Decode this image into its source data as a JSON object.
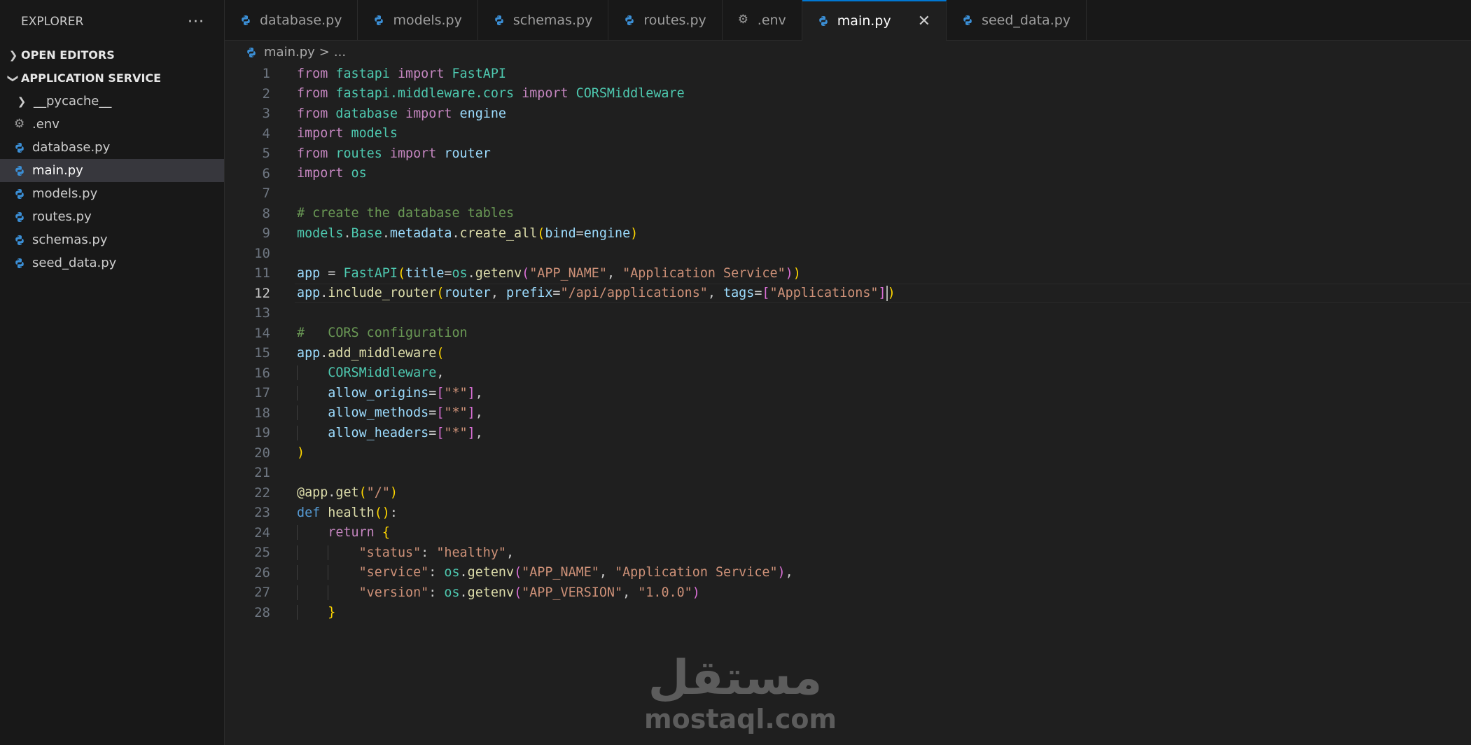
{
  "sidebar": {
    "title": "EXPLORER",
    "more_label": "···",
    "open_editors": "OPEN EDITORS",
    "project": "APPLICATION SERVICE",
    "items": [
      {
        "label": "__pycache__",
        "icon": "chevron-right-icon",
        "kind": "folder"
      },
      {
        "label": ".env",
        "icon": "gear-icon",
        "kind": "env"
      },
      {
        "label": "database.py",
        "icon": "python-icon",
        "kind": "py"
      },
      {
        "label": "main.py",
        "icon": "python-icon",
        "kind": "py",
        "active": true
      },
      {
        "label": "models.py",
        "icon": "python-icon",
        "kind": "py"
      },
      {
        "label": "routes.py",
        "icon": "python-icon",
        "kind": "py"
      },
      {
        "label": "schemas.py",
        "icon": "python-icon",
        "kind": "py"
      },
      {
        "label": "seed_data.py",
        "icon": "python-icon",
        "kind": "py"
      }
    ]
  },
  "tabs": [
    {
      "label": "database.py",
      "icon": "python-icon"
    },
    {
      "label": "models.py",
      "icon": "python-icon"
    },
    {
      "label": "schemas.py",
      "icon": "python-icon"
    },
    {
      "label": "routes.py",
      "icon": "python-icon"
    },
    {
      "label": ".env",
      "icon": "gear-icon"
    },
    {
      "label": "main.py",
      "icon": "python-icon",
      "active": true,
      "close": "✕"
    },
    {
      "label": "seed_data.py",
      "icon": "python-icon"
    }
  ],
  "breadcrumb": {
    "file": "main.py",
    "sep": ">",
    "rest": "..."
  },
  "editor": {
    "current_line": 12,
    "lines": [
      [
        [
          "kw",
          "from"
        ],
        [
          "pl",
          " "
        ],
        [
          "mod",
          "fastapi"
        ],
        [
          "pl",
          " "
        ],
        [
          "kw",
          "import"
        ],
        [
          "pl",
          " "
        ],
        [
          "cls",
          "FastAPI"
        ]
      ],
      [
        [
          "kw",
          "from"
        ],
        [
          "pl",
          " "
        ],
        [
          "mod",
          "fastapi.middleware.cors"
        ],
        [
          "pl",
          " "
        ],
        [
          "kw",
          "import"
        ],
        [
          "pl",
          " "
        ],
        [
          "cls",
          "CORSMiddleware"
        ]
      ],
      [
        [
          "kw",
          "from"
        ],
        [
          "pl",
          " "
        ],
        [
          "mod",
          "database"
        ],
        [
          "pl",
          " "
        ],
        [
          "kw",
          "import"
        ],
        [
          "pl",
          " "
        ],
        [
          "var",
          "engine"
        ]
      ],
      [
        [
          "kw",
          "import"
        ],
        [
          "pl",
          " "
        ],
        [
          "mod",
          "models"
        ]
      ],
      [
        [
          "kw",
          "from"
        ],
        [
          "pl",
          " "
        ],
        [
          "mod",
          "routes"
        ],
        [
          "pl",
          " "
        ],
        [
          "kw",
          "import"
        ],
        [
          "pl",
          " "
        ],
        [
          "var",
          "router"
        ]
      ],
      [
        [
          "kw",
          "import"
        ],
        [
          "pl",
          " "
        ],
        [
          "mod",
          "os"
        ]
      ],
      [],
      [
        [
          "cmt",
          "# create the database tables"
        ]
      ],
      [
        [
          "mod",
          "models"
        ],
        [
          "pl",
          "."
        ],
        [
          "cls",
          "Base"
        ],
        [
          "pl",
          "."
        ],
        [
          "var",
          "metadata"
        ],
        [
          "pl",
          "."
        ],
        [
          "fn",
          "create_all"
        ],
        [
          "b1",
          "("
        ],
        [
          "var",
          "bind"
        ],
        [
          "pl",
          "="
        ],
        [
          "var",
          "engine"
        ],
        [
          "b1",
          ")"
        ]
      ],
      [],
      [
        [
          "var",
          "app"
        ],
        [
          "pl",
          " = "
        ],
        [
          "cls",
          "FastAPI"
        ],
        [
          "b1",
          "("
        ],
        [
          "var",
          "title"
        ],
        [
          "pl",
          "="
        ],
        [
          "mod",
          "os"
        ],
        [
          "pl",
          "."
        ],
        [
          "fn",
          "getenv"
        ],
        [
          "b2",
          "("
        ],
        [
          "str",
          "\"APP_NAME\""
        ],
        [
          "pl",
          ", "
        ],
        [
          "str",
          "\"Application Service\""
        ],
        [
          "b2",
          ")"
        ],
        [
          "b1",
          ")"
        ]
      ],
      [
        [
          "var",
          "app"
        ],
        [
          "pl",
          "."
        ],
        [
          "fn",
          "include_router"
        ],
        [
          "b1",
          "("
        ],
        [
          "var",
          "router"
        ],
        [
          "pl",
          ", "
        ],
        [
          "var",
          "prefix"
        ],
        [
          "pl",
          "="
        ],
        [
          "str",
          "\"/api/applications\""
        ],
        [
          "pl",
          ", "
        ],
        [
          "var",
          "tags"
        ],
        [
          "pl",
          "="
        ],
        [
          "b2",
          "["
        ],
        [
          "str",
          "\"Applications\""
        ],
        [
          "b2",
          "]"
        ],
        [
          "cursor",
          ""
        ],
        [
          "b1",
          ")"
        ]
      ],
      [],
      [
        [
          "cmt",
          "#   CORS configuration"
        ]
      ],
      [
        [
          "var",
          "app"
        ],
        [
          "pl",
          "."
        ],
        [
          "fn",
          "add_middleware"
        ],
        [
          "b1",
          "("
        ]
      ],
      [
        [
          "pl",
          "    "
        ],
        [
          "cls",
          "CORSMiddleware"
        ],
        [
          "pl",
          ","
        ]
      ],
      [
        [
          "pl",
          "    "
        ],
        [
          "var",
          "allow_origins"
        ],
        [
          "pl",
          "="
        ],
        [
          "b2",
          "["
        ],
        [
          "str",
          "\"*\""
        ],
        [
          "b2",
          "]"
        ],
        [
          "pl",
          ","
        ]
      ],
      [
        [
          "pl",
          "    "
        ],
        [
          "var",
          "allow_methods"
        ],
        [
          "pl",
          "="
        ],
        [
          "b2",
          "["
        ],
        [
          "str",
          "\"*\""
        ],
        [
          "b2",
          "]"
        ],
        [
          "pl",
          ","
        ]
      ],
      [
        [
          "pl",
          "    "
        ],
        [
          "var",
          "allow_headers"
        ],
        [
          "pl",
          "="
        ],
        [
          "b2",
          "["
        ],
        [
          "str",
          "\"*\""
        ],
        [
          "b2",
          "]"
        ],
        [
          "pl",
          ","
        ]
      ],
      [
        [
          "b1",
          ")"
        ]
      ],
      [],
      [
        [
          "fn",
          "@app"
        ],
        [
          "pl",
          "."
        ],
        [
          "fn",
          "get"
        ],
        [
          "b1",
          "("
        ],
        [
          "str",
          "\"/\""
        ],
        [
          "b1",
          ")"
        ]
      ],
      [
        [
          "kd",
          "def"
        ],
        [
          "pl",
          " "
        ],
        [
          "fn",
          "health"
        ],
        [
          "b1",
          "()"
        ],
        [
          "pl",
          ":"
        ]
      ],
      [
        [
          "pl",
          "    "
        ],
        [
          "kw",
          "return"
        ],
        [
          "pl",
          " "
        ],
        [
          "b1",
          "{"
        ]
      ],
      [
        [
          "pl",
          "        "
        ],
        [
          "str",
          "\"status\""
        ],
        [
          "pl",
          ": "
        ],
        [
          "str",
          "\"healthy\""
        ],
        [
          "pl",
          ","
        ]
      ],
      [
        [
          "pl",
          "        "
        ],
        [
          "str",
          "\"service\""
        ],
        [
          "pl",
          ": "
        ],
        [
          "mod",
          "os"
        ],
        [
          "pl",
          "."
        ],
        [
          "fn",
          "getenv"
        ],
        [
          "b2",
          "("
        ],
        [
          "str",
          "\"APP_NAME\""
        ],
        [
          "pl",
          ", "
        ],
        [
          "str",
          "\"Application Service\""
        ],
        [
          "b2",
          ")"
        ],
        [
          "pl",
          ","
        ]
      ],
      [
        [
          "pl",
          "        "
        ],
        [
          "str",
          "\"version\""
        ],
        [
          "pl",
          ": "
        ],
        [
          "mod",
          "os"
        ],
        [
          "pl",
          "."
        ],
        [
          "fn",
          "getenv"
        ],
        [
          "b2",
          "("
        ],
        [
          "str",
          "\"APP_VERSION\""
        ],
        [
          "pl",
          ", "
        ],
        [
          "str",
          "\"1.0.0\""
        ],
        [
          "b2",
          ")"
        ]
      ],
      [
        [
          "pl",
          "    "
        ],
        [
          "b1",
          "}"
        ]
      ]
    ]
  },
  "watermark": {
    "arabic": "مستقل",
    "latin": "mostaql.com"
  }
}
